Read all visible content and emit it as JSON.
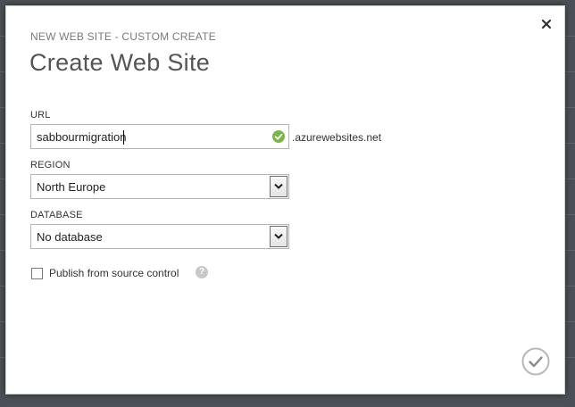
{
  "dialog": {
    "kicker": "NEW WEB SITE - CUSTOM CREATE",
    "title": "Create Web Site",
    "close_icon": "close-icon",
    "submit_icon": "checkmark-circle-icon"
  },
  "form": {
    "url": {
      "label": "URL",
      "value": "sabbourmigration",
      "suffix": ".azurewebsites.net",
      "status_icon": "checkmark-green-icon",
      "status_color": "#7ab648"
    },
    "region": {
      "label": "REGION",
      "selected": "North Europe"
    },
    "database": {
      "label": "DATABASE",
      "selected": "No database"
    },
    "publish": {
      "label": "Publish from source control",
      "checked": false,
      "help_text": "?"
    }
  }
}
